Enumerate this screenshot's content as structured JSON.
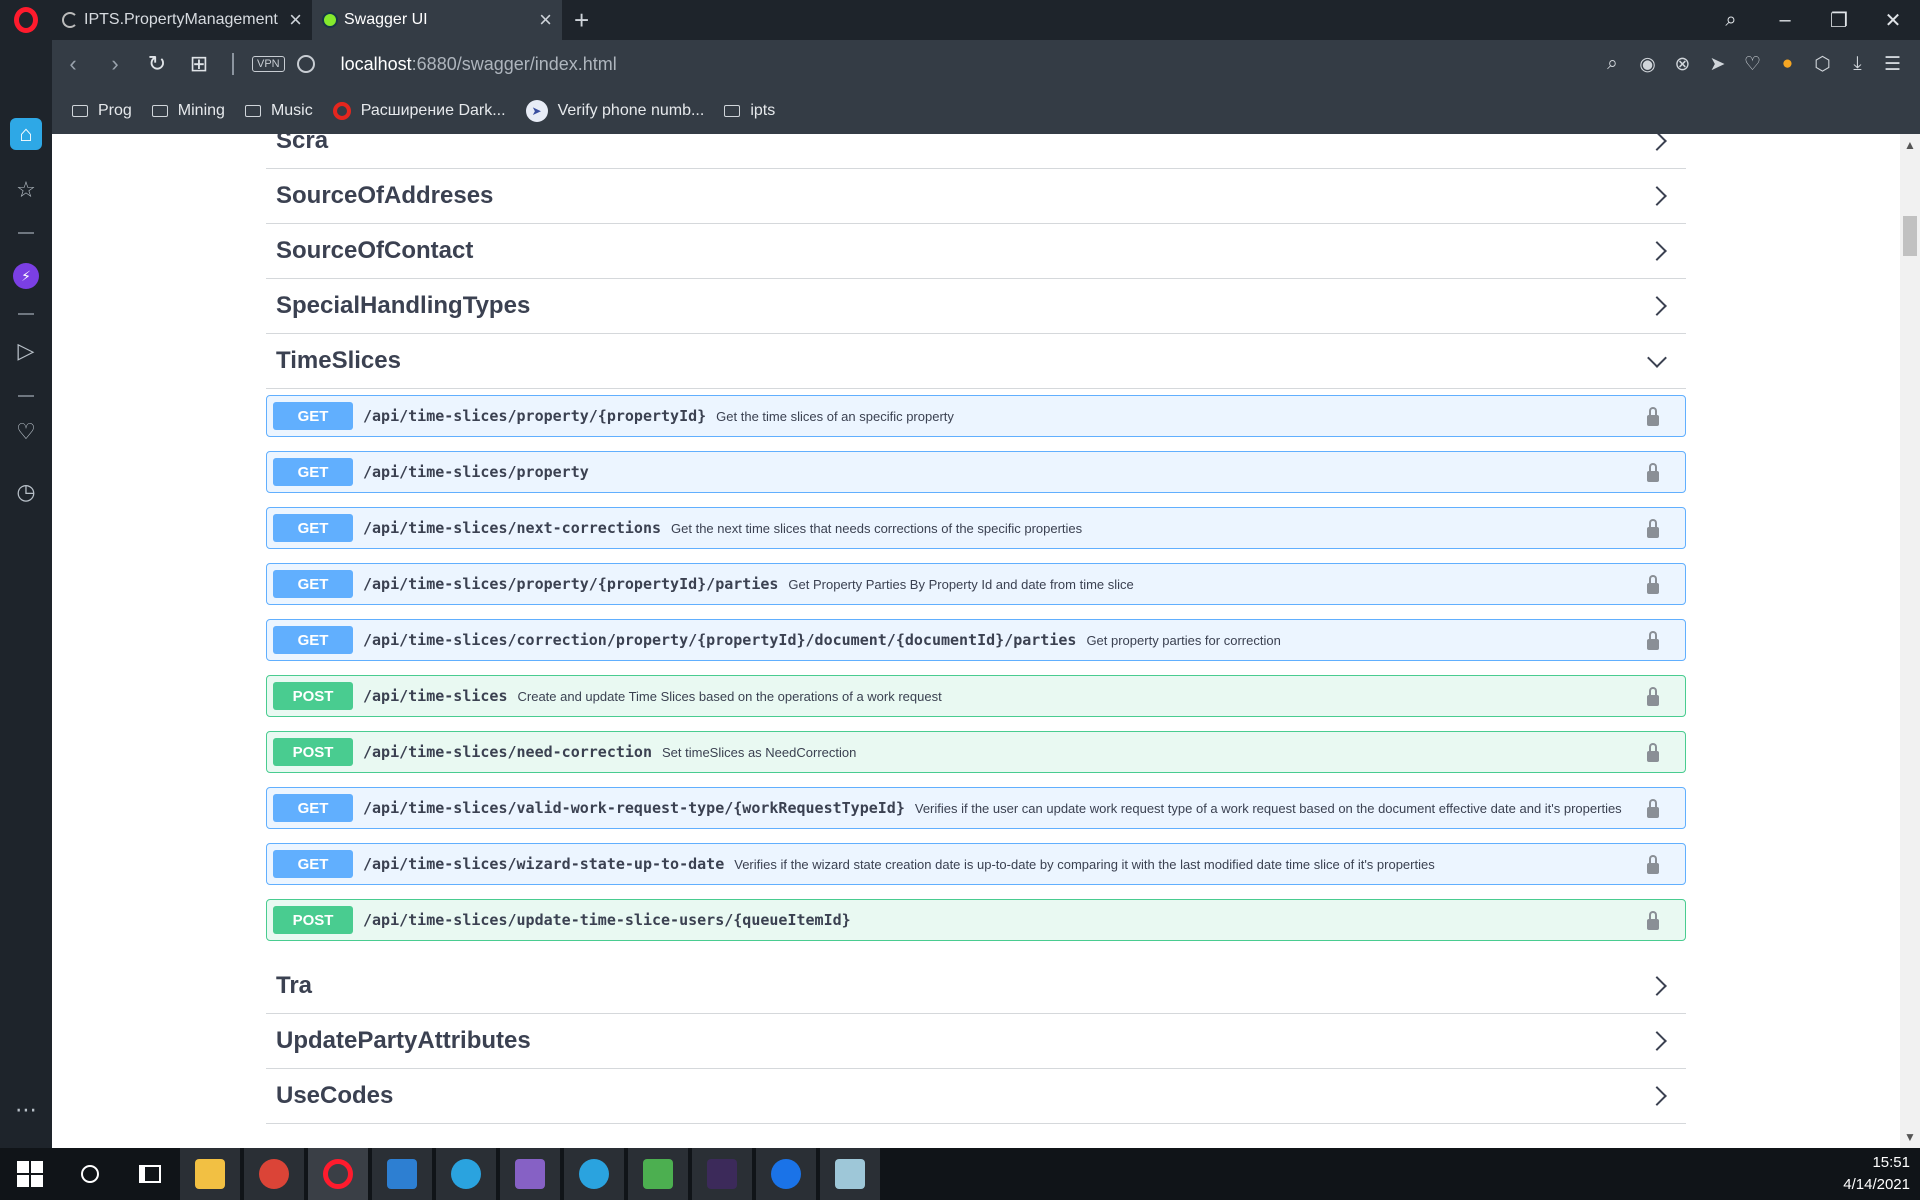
{
  "browser": {
    "tabs": [
      {
        "title": "IPTS.PropertyManagement",
        "state": "loading"
      },
      {
        "title": "Swagger UI",
        "state": "active"
      }
    ],
    "address": {
      "host": "localhost",
      "rest": ":6880/swagger/index.html"
    },
    "vpn_label": "VPN",
    "bookmarks": [
      {
        "label": "Prog",
        "icon": "folder-icon"
      },
      {
        "label": "Mining",
        "icon": "folder-icon"
      },
      {
        "label": "Music",
        "icon": "folder-icon"
      },
      {
        "label": "Расширение Dark...",
        "icon": "opera-icon"
      },
      {
        "label": "Verify phone numb...",
        "icon": "verify-icon"
      },
      {
        "label": "ipts",
        "icon": "folder-icon"
      }
    ]
  },
  "swagger": {
    "tags_top": [
      {
        "name": "Scra"
      },
      {
        "name": "SourceOfAddreses"
      },
      {
        "name": "SourceOfContact"
      },
      {
        "name": "SpecialHandlingTypes"
      }
    ],
    "open_tag": {
      "name": "TimeSlices",
      "operations": [
        {
          "method": "GET",
          "path": "/api/time-slices/property/{propertyId}",
          "summary": "Get the time slices of an specific property"
        },
        {
          "method": "GET",
          "path": "/api/time-slices/property",
          "summary": ""
        },
        {
          "method": "GET",
          "path": "/api/time-slices/next-corrections",
          "summary": "Get the next time slices that needs corrections of the specific properties"
        },
        {
          "method": "GET",
          "path": "/api/time-slices/property/{propertyId}/parties",
          "summary": "Get Property Parties By Property Id and date from time slice"
        },
        {
          "method": "GET",
          "path": "/api/time-slices/correction/property/{propertyId}/document/{documentId}/parties",
          "summary": "Get property parties for correction"
        },
        {
          "method": "POST",
          "path": "/api/time-slices",
          "summary": "Create and update Time Slices based on the operations of a work request"
        },
        {
          "method": "POST",
          "path": "/api/time-slices/need-correction",
          "summary": "Set timeSlices as NeedCorrection"
        },
        {
          "method": "GET",
          "path": "/api/time-slices/valid-work-request-type/{workRequestTypeId}",
          "summary": "Verifies if the user can update work request type of a work request based on the document effective date and it's properties"
        },
        {
          "method": "GET",
          "path": "/api/time-slices/wizard-state-up-to-date",
          "summary": "Verifies if the wizard state creation date is up-to-date by comparing it with the last modified date time slice of it's properties"
        },
        {
          "method": "POST",
          "path": "/api/time-slices/update-time-slice-users/{queueItemId}",
          "summary": ""
        }
      ]
    },
    "tags_bottom": [
      {
        "name": "Tra"
      },
      {
        "name": "UpdatePartyAttributes"
      },
      {
        "name": "UseCodes"
      }
    ]
  },
  "colors": {
    "get": "#61affe",
    "post": "#49cc90",
    "text": "#3b4151"
  },
  "taskbar": {
    "time": "15:51",
    "date": "4/14/2021"
  }
}
